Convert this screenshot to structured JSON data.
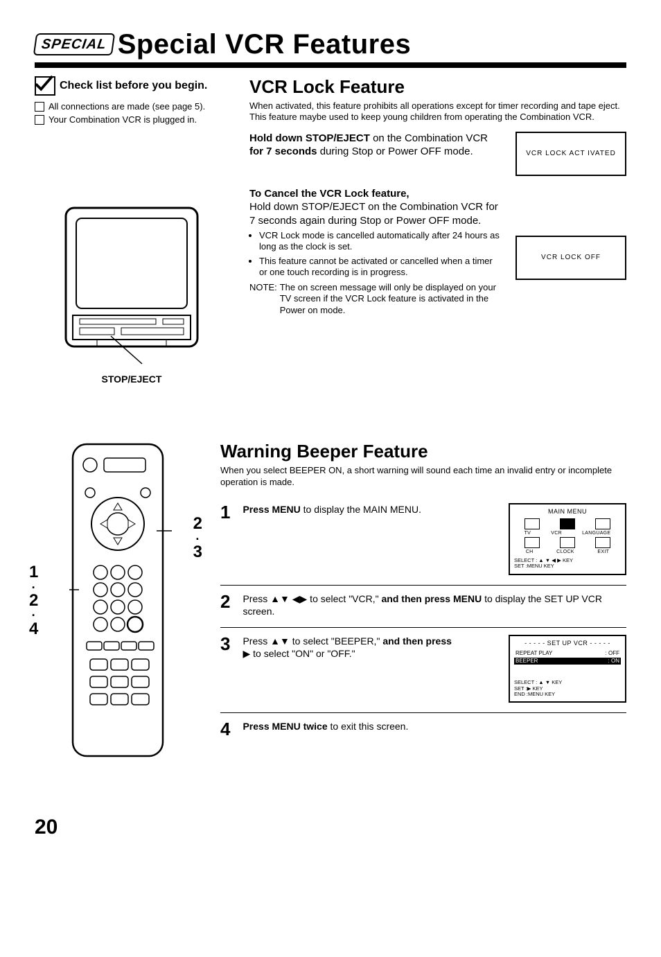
{
  "header": {
    "badge": "SPECIAL",
    "title": "Special VCR Features"
  },
  "checklist": {
    "heading": "Check list before you begin.",
    "items": [
      "All connections are made (see page 5).",
      "Your Combination VCR is plugged in."
    ]
  },
  "vcr_lock": {
    "title": "VCR Lock Feature",
    "intro": "When activated, this feature prohibits all operations except for timer recording and tape eject. This feature maybe used to keep young children from operating the Combination VCR.",
    "activate_bold1": "Hold down STOP/EJECT",
    "activate_mid": " on the Combination VCR ",
    "activate_bold2": "for 7 seconds",
    "activate_end": " during Stop or Power OFF mode.",
    "display_on": "VCR  LOCK  ACT IVATED",
    "cancel_heading": "To Cancel the VCR Lock feature,",
    "cancel_text": "Hold down STOP/EJECT on the Combination VCR for 7 seconds again during Stop or Power OFF mode.",
    "bullets": [
      "VCR Lock mode is cancelled automatically after 24 hours as long as the clock is set.",
      "This feature cannot be activated or cancelled when a timer or one touch recording is in progress."
    ],
    "display_off": "VCR  LOCK  OFF",
    "note_label": "NOTE:",
    "note_text": "The on screen message will only be displayed on your TV screen if the VCR Lock feature is activated in the Power on mode."
  },
  "tv_label": "STOP/EJECT",
  "remote_callouts": {
    "left": "1\n·\n2\n·\n4",
    "right": "2\n·\n3"
  },
  "beeper": {
    "title": "Warning Beeper Feature",
    "intro": "When you select BEEPER ON, a short warning will sound each time an invalid entry or incomplete operation is made.",
    "steps": [
      {
        "n": "1",
        "bold": "Press MENU",
        "rest": " to display the MAIN MENU."
      },
      {
        "n": "2",
        "pre": "Press  ",
        "arrows": "▲▼ ◀▶",
        "mid": "  to select \"VCR,\" ",
        "bold": "and then press MENU",
        "rest": " to display the SET UP VCR screen."
      },
      {
        "n": "3",
        "pre": "Press  ",
        "arrows": "▲▼",
        "mid": "  to select \"BEEPER,\" ",
        "bold": "and then press",
        "sub_arrow": "▶",
        "sub_rest": "  to select \"ON\" or \"OFF.\""
      },
      {
        "n": "4",
        "bold": "Press MENU twice",
        "rest": " to exit this screen."
      }
    ]
  },
  "osd_main": {
    "title": "MAIN MENU",
    "row1": [
      "TV",
      "VCR",
      "LANGUAGE"
    ],
    "row2": [
      "CH",
      "CLOCK",
      "EXIT"
    ],
    "footer1": "SELECT : ▲ ▼ ◀ ▶  KEY",
    "footer2": "SET      :MENU KEY"
  },
  "osd_setup": {
    "title": "- - - - -  SET  UP  VCR  - - - - -",
    "line1_l": "REPEAT PLAY",
    "line1_r": ":   OFF",
    "line2_l": "BEEPER",
    "line2_r": ":   ON",
    "footer1": "SELECT : ▲  ▼  KEY",
    "footer2": "SET      :▶ KEY",
    "footer3": "END      :MENU  KEY"
  },
  "page_number": "20"
}
